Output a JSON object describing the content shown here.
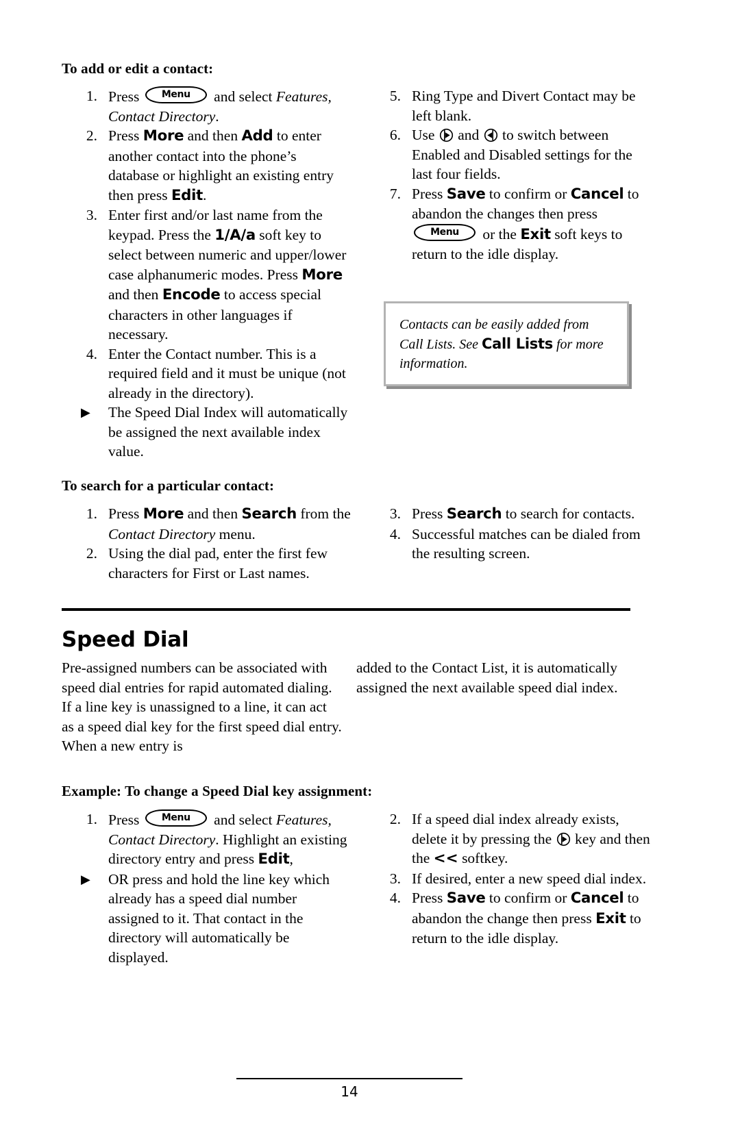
{
  "page": {
    "number": "14"
  },
  "icons": {
    "menu_key_label": "Menu",
    "nav_right_key": "nav-right-key-icon",
    "nav_left_key": "nav-left-key-icon",
    "triangle_bullet": "▶"
  },
  "section_add_edit": {
    "heading": "To add or edit a contact:",
    "steps": [
      {
        "num": "1.",
        "parts": [
          {
            "t": "text",
            "v": "Press "
          },
          {
            "t": "menukey",
            "v": "Menu"
          },
          {
            "t": "text",
            "v": " and select "
          },
          {
            "t": "italic",
            "v": "Features, Contact Directory"
          },
          {
            "t": "text",
            "v": "."
          }
        ]
      },
      {
        "num": "2.",
        "parts": [
          {
            "t": "text",
            "v": "Press "
          },
          {
            "t": "softkey",
            "v": "More"
          },
          {
            "t": "text",
            "v": " and then "
          },
          {
            "t": "softkey",
            "v": "Add"
          },
          {
            "t": "text",
            "v": " to enter another contact into the phone’s database or highlight an existing entry then press "
          },
          {
            "t": "softkey",
            "v": "Edit"
          },
          {
            "t": "text",
            "v": "."
          }
        ]
      },
      {
        "num": "3.",
        "parts": [
          {
            "t": "text",
            "v": "Enter first and/or last name from the keypad.  Press the "
          },
          {
            "t": "softkey",
            "v": "1/A/a"
          },
          {
            "t": "text",
            "v": " soft key to select between numeric and upper/lower case alphanumeric modes.  Press "
          },
          {
            "t": "softkey",
            "v": "More"
          },
          {
            "t": "text",
            "v": " and then "
          },
          {
            "t": "softkey",
            "v": "Encode"
          },
          {
            "t": "text",
            "v": "  to access special characters in other languages if necessary."
          }
        ]
      },
      {
        "num": "4.",
        "parts": [
          {
            "t": "text",
            "v": "Enter the Contact number.  This is a required field and it must be unique (not already in the directory)."
          }
        ]
      }
    ],
    "bullet": {
      "marker": "▶",
      "parts": [
        {
          "t": "text",
          "v": "The Speed Dial Index will automatically be assigned the next available index value."
        }
      ]
    },
    "steps_right": [
      {
        "num": "5.",
        "parts": [
          {
            "t": "text",
            "v": "Ring Type and Divert Contact may be left blank."
          }
        ]
      },
      {
        "num": "6.",
        "parts": [
          {
            "t": "text",
            "v": "Use "
          },
          {
            "t": "navright",
            "v": "nav-right-key-icon"
          },
          {
            "t": "text",
            "v": " and "
          },
          {
            "t": "navleft",
            "v": "nav-left-key-icon"
          },
          {
            "t": "text",
            "v": " to switch between Enabled and Disabled settings for the last four fields."
          }
        ]
      },
      {
        "num": "7.",
        "parts": [
          {
            "t": "text",
            "v": "Press "
          },
          {
            "t": "softkey",
            "v": "Save"
          },
          {
            "t": "text",
            "v": " to confirm or "
          },
          {
            "t": "softkey",
            "v": "Cancel"
          },
          {
            "t": "text",
            "v": " to abandon the changes then press "
          },
          {
            "t": "menukey",
            "v": "Menu"
          },
          {
            "t": "text",
            "v": " or the "
          },
          {
            "t": "softkey",
            "v": "Exit"
          },
          {
            "t": "text",
            "v": " soft keys to return to the idle display."
          }
        ]
      }
    ]
  },
  "callout": {
    "parts": [
      {
        "t": "italic",
        "v": "Contacts can be easily added from Call Lists.  See "
      },
      {
        "t": "boldsans",
        "v": "Call Lists"
      },
      {
        "t": "italic",
        "v": " for more information."
      }
    ]
  },
  "section_search": {
    "heading": "To search for a particular contact:",
    "steps_left": [
      {
        "num": "1.",
        "parts": [
          {
            "t": "text",
            "v": "Press "
          },
          {
            "t": "softkey",
            "v": "More"
          },
          {
            "t": "text",
            "v": " and then "
          },
          {
            "t": "softkey",
            "v": "Search"
          },
          {
            "t": "text",
            "v": " from the "
          },
          {
            "t": "italic",
            "v": "Contact Directory"
          },
          {
            "t": "text",
            "v": " menu."
          }
        ]
      },
      {
        "num": "2.",
        "parts": [
          {
            "t": "text",
            "v": "Using the dial pad, enter the first few characters for First or Last names."
          }
        ]
      }
    ],
    "steps_right": [
      {
        "num": "3.",
        "parts": [
          {
            "t": "text",
            "v": "Press "
          },
          {
            "t": "softkey",
            "v": "Search"
          },
          {
            "t": "text",
            "v": " to search for contacts."
          }
        ]
      },
      {
        "num": "4.",
        "parts": [
          {
            "t": "text",
            "v": "Successful matches can be dialed from the resulting screen."
          }
        ]
      }
    ]
  },
  "speed_dial": {
    "heading": "Speed Dial",
    "body_left": "Pre-assigned numbers can be associated with speed dial entries for rapid automated dialing.  If a line key is unassigned to a line, it can act as a speed dial key for the first speed dial entry.  When a new entry is",
    "body_right": "added to the Contact List, it is automatically assigned the next available speed dial index.",
    "example_heading": "Example: To change a Speed Dial key assignment:",
    "steps_left": [
      {
        "num": "1.",
        "parts": [
          {
            "t": "text",
            "v": "Press "
          },
          {
            "t": "menukey",
            "v": "Menu"
          },
          {
            "t": "text",
            "v": " and select "
          },
          {
            "t": "italic",
            "v": "Features, Contact Directory"
          },
          {
            "t": "text",
            "v": ".  Highlight an existing directory entry and press "
          },
          {
            "t": "softkey",
            "v": "Edit"
          },
          {
            "t": "text",
            "v": ","
          }
        ]
      }
    ],
    "bullet_left": {
      "marker": "▶",
      "parts": [
        {
          "t": "text",
          "v": "OR press and hold the line key which already has a speed dial number assigned to it.  That contact in the directory will automatically be displayed."
        }
      ]
    },
    "steps_right": [
      {
        "num": "2.",
        "parts": [
          {
            "t": "text",
            "v": "If a speed dial index already exists, delete it by pressing the "
          },
          {
            "t": "navright",
            "v": "nav-right-key-icon"
          },
          {
            "t": "text",
            "v": " key and then the "
          },
          {
            "t": "softkeyw",
            "v": "<<"
          },
          {
            "t": "text",
            "v": " softkey."
          }
        ]
      },
      {
        "num": "3.",
        "parts": [
          {
            "t": "text",
            "v": "If desired, enter a new speed dial index."
          }
        ]
      },
      {
        "num": "4.",
        "parts": [
          {
            "t": "text",
            "v": "Press "
          },
          {
            "t": "softkey",
            "v": "Save"
          },
          {
            "t": "text",
            "v": " to confirm or "
          },
          {
            "t": "softkey",
            "v": "Cancel"
          },
          {
            "t": "text",
            "v": " to abandon the change then press "
          },
          {
            "t": "softkey",
            "v": "Exit"
          },
          {
            "t": "text",
            "v": " to return to the idle display."
          }
        ]
      }
    ]
  }
}
